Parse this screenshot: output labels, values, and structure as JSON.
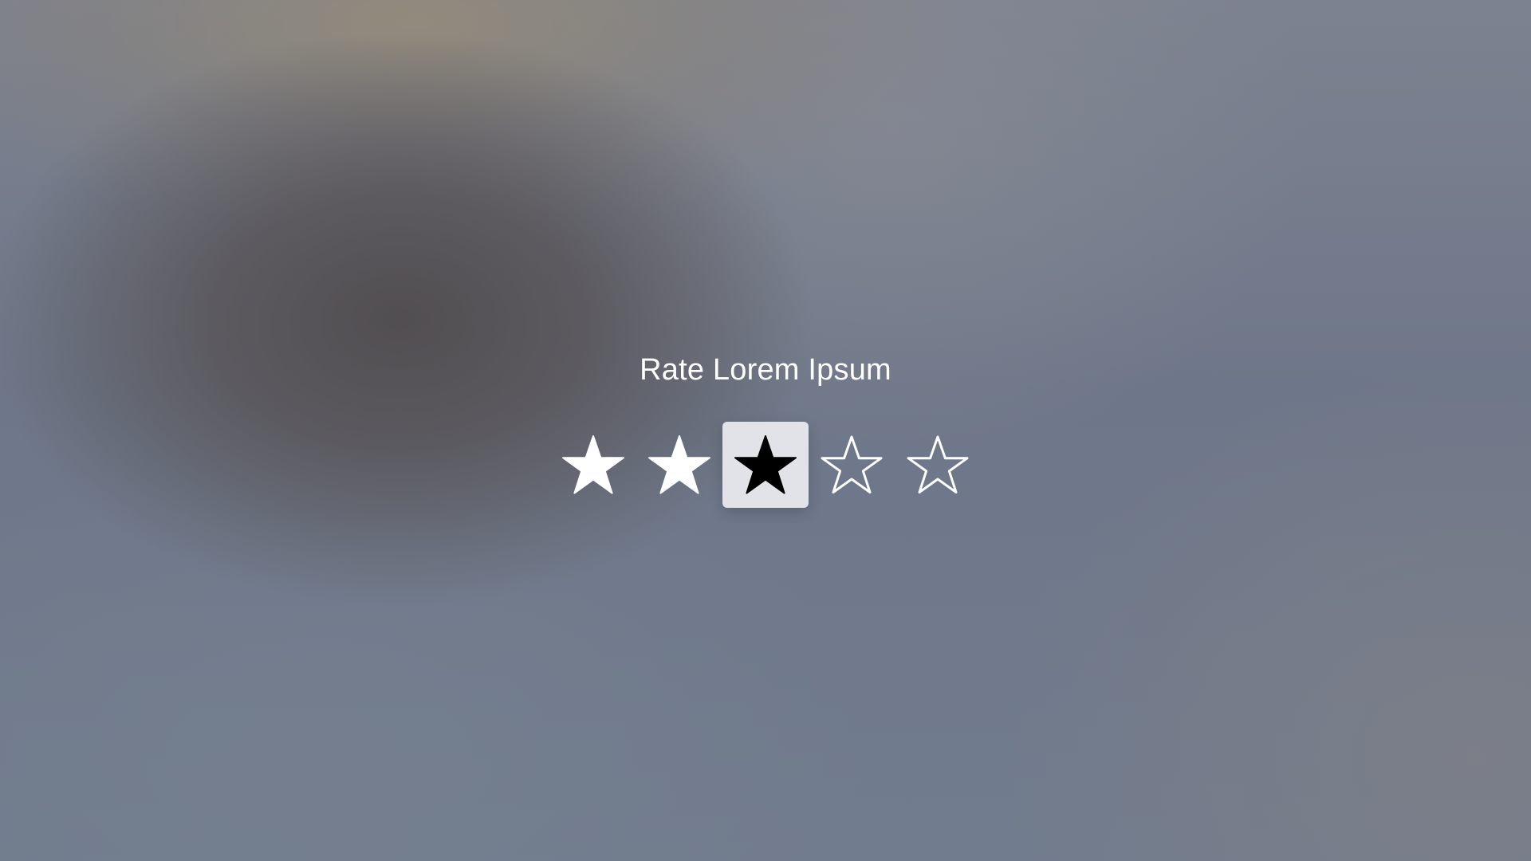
{
  "dialog": {
    "title": "Rate Lorem Ipsum"
  },
  "rating": {
    "max": 5,
    "value": 3,
    "focused_star": 3,
    "stars": [
      {
        "index": 1,
        "state": "filled",
        "icon": "star-filled-icon"
      },
      {
        "index": 2,
        "state": "filled",
        "icon": "star-filled-icon"
      },
      {
        "index": 3,
        "state": "focused",
        "icon": "star-filled-icon"
      },
      {
        "index": 4,
        "state": "empty",
        "icon": "star-outline-icon"
      },
      {
        "index": 5,
        "state": "empty",
        "icon": "star-outline-icon"
      }
    ]
  },
  "colors": {
    "text": "#ffffff",
    "focus_background": "#e1e3e8",
    "focused_star": "#000000",
    "star": "#ffffff"
  }
}
